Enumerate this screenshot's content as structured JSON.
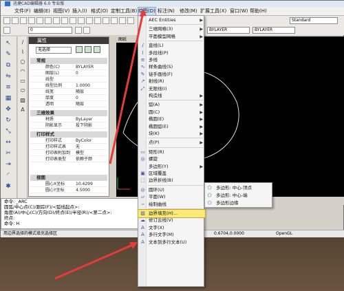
{
  "titlebar": {
    "app_name": "迅捷CAD编辑器 6.0 专业版"
  },
  "menubar": {
    "items": [
      {
        "label": "文件(F)"
      },
      {
        "label": "编辑(E)"
      },
      {
        "label": "视图(V)"
      },
      {
        "label": "插入(I)"
      },
      {
        "label": "格式(O)"
      },
      {
        "label": "定制工具(B)"
      },
      {
        "label": "绘图(D)"
      },
      {
        "label": "标注(N)"
      },
      {
        "label": "修改(M)"
      },
      {
        "label": "扩展工具(X)"
      },
      {
        "label": "窗口(W)"
      },
      {
        "label": "帮助(H)"
      }
    ]
  },
  "toolbar": {
    "layer_combo": "0",
    "linetype_combo": "BYLAYER",
    "lineweight_combo": "BYLAYER",
    "textstyle_combo": "Standard"
  },
  "properties": {
    "title": "属性",
    "select_value": "无选择",
    "sections": {
      "general": "常规",
      "3d": "三维效果",
      "plot": "打印样式",
      "view": "视图"
    },
    "rows_general": [
      {
        "k": "颜色(C)",
        "v": "BYLAYER"
      },
      {
        "k": "图层(L)",
        "v": "0"
      },
      {
        "k": "线型",
        "v": ""
      },
      {
        "k": "线型比例",
        "v": "1.0000"
      },
      {
        "k": "线宽",
        "v": "随层"
      },
      {
        "k": "厚度",
        "v": "0"
      },
      {
        "k": "透明",
        "v": "随层"
      }
    ],
    "rows_3d": [
      {
        "k": "材质",
        "v": "ByLayer"
      },
      {
        "k": "阴影显示",
        "v": "投下阴影"
      }
    ],
    "rows_plot": [
      {
        "k": "打印样式",
        "v": "ByColor"
      },
      {
        "k": "打印样式表",
        "v": "无"
      },
      {
        "k": "打印表附加到",
        "v": "模型"
      },
      {
        "k": "打印表类型",
        "v": "依赖于颜"
      }
    ],
    "rows_view": [
      {
        "k": "圆心X坐标",
        "v": "10.4299"
      },
      {
        "k": "圆心Y坐标",
        "v": "4.5000"
      }
    ]
  },
  "canvas": {
    "tab_label": "图纸"
  },
  "commandline": {
    "lines": [
      "命令: _ARC",
      "圆弧/中心点(C)/跟踪(F)/<弧线起点>:",
      "角度(A)/中心(C)/方向(D)/终点(E)/半径(R)/<第二点>:",
      "终点:",
      "命令: H"
    ]
  },
  "statusbar": {
    "hint": "用边界选择的模式填充选择区",
    "coords": "0.6704,0.0000",
    "renderer": "OpenGL"
  },
  "draw_menu": {
    "items": [
      {
        "label": "AEC Entities",
        "icon": "blank",
        "sub": true
      },
      {
        "sep": true
      },
      {
        "label": "三维网格(3)",
        "icon": "blank",
        "sub": true
      },
      {
        "label": "平面模型网格",
        "icon": "blank",
        "sub": true
      },
      {
        "sep": true
      },
      {
        "label": "直线(L)",
        "icon": "line-icon",
        "sub": false
      },
      {
        "label": "多段线(P)",
        "icon": "polyline-icon",
        "sub": false
      },
      {
        "label": "多线",
        "icon": "multiline-icon",
        "sub": false
      },
      {
        "label": "样条曲线(S)",
        "icon": "spline-icon",
        "sub": false
      },
      {
        "label": "徒手画线(F)",
        "icon": "freehand-icon",
        "sub": false
      },
      {
        "label": "射线(R)",
        "icon": "ray-icon",
        "sub": false
      },
      {
        "label": "无限线(I)",
        "icon": "xline-icon",
        "sub": false
      },
      {
        "label": "构造线",
        "icon": "blank",
        "sub": true
      },
      {
        "sep": true
      },
      {
        "label": "弧(A)",
        "icon": "blank",
        "sub": true
      },
      {
        "label": "圆(C)",
        "icon": "blank",
        "sub": true
      },
      {
        "label": "椭圆(E)",
        "icon": "blank",
        "sub": true
      },
      {
        "label": "椭圆弧(E)",
        "icon": "blank",
        "sub": true
      },
      {
        "label": "块(K)",
        "icon": "blank",
        "sub": true
      },
      {
        "sep": true
      },
      {
        "label": "点(P)",
        "icon": "blank",
        "sub": true
      },
      {
        "sep": true
      },
      {
        "label": "矩形(R)",
        "icon": "rect-icon",
        "sub": false
      },
      {
        "label": "螺旋",
        "icon": "helix-icon",
        "sub": false
      },
      {
        "label": "多边形(Y)",
        "icon": "blank",
        "sub": true
      },
      {
        "label": "区域覆盖",
        "icon": "wipeout-icon",
        "sub": false
      },
      {
        "label": "边界折线(B)",
        "icon": "boundary-icon",
        "sub": false
      },
      {
        "sep": true
      },
      {
        "label": "圆环(U)",
        "icon": "donut-icon",
        "sub": false
      },
      {
        "label": "平面(W)",
        "icon": "plane-icon",
        "sub": false
      },
      {
        "label": "绘制曲线",
        "icon": "curve-icon",
        "sub": false
      },
      {
        "sep": true
      },
      {
        "label": "边界填充(H)...",
        "icon": "hatch-icon",
        "sub": false,
        "highlight": true
      },
      {
        "label": "修订云线(V)",
        "icon": "revcloud-icon",
        "sub": false
      },
      {
        "label": "文字(X)",
        "icon": "text-icon",
        "sub": false
      },
      {
        "label": "多行文字(M)",
        "icon": "mtext-icon",
        "sub": false
      },
      {
        "label": "文本到多行文本(U)",
        "icon": "mtext-icon",
        "sub": false
      }
    ]
  },
  "polygon_submenu": {
    "items": [
      {
        "label": "多边形: 中心-顶点"
      },
      {
        "label": "多边形: 中心-端"
      },
      {
        "label": "多边形边缘"
      }
    ]
  },
  "colors": {
    "annotation_arrow": "#e53b3b",
    "highlight": "#fbe97a"
  }
}
